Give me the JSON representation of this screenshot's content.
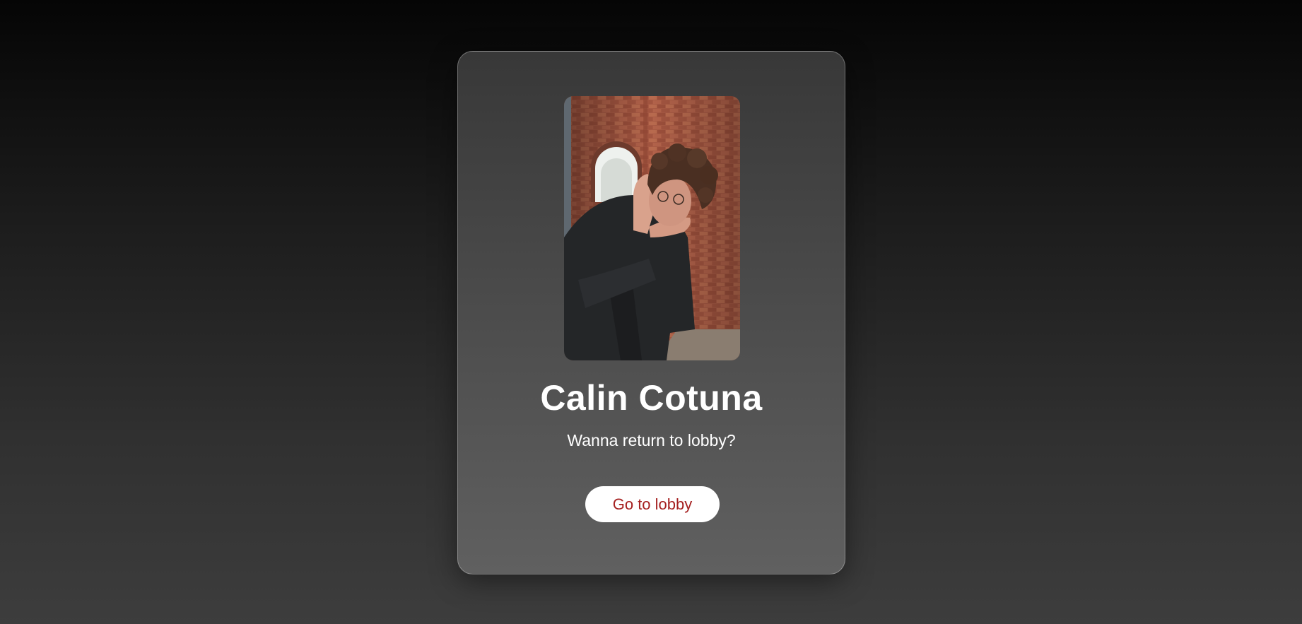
{
  "profile": {
    "name": "Calin Cotuna",
    "subtitle": "Wanna return to lobby?",
    "photo_alt": "Calin Cotuna"
  },
  "actions": {
    "lobby_button_label": "Go to lobby"
  },
  "colors": {
    "button_text": "#a52020",
    "button_background": "#ffffff",
    "heading_text": "#ffffff"
  }
}
